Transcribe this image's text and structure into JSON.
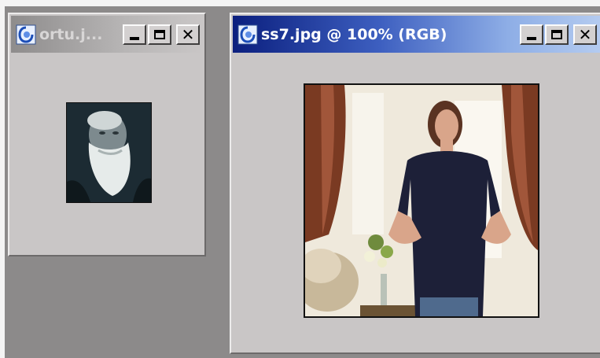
{
  "windows": [
    {
      "id": "inactive",
      "title": "ortu.j...",
      "state": "inactive",
      "image": "portrait of bearded elderly man (grayscale)"
    },
    {
      "id": "active",
      "title": "ss7.jpg @ 100% (RGB)",
      "state": "active",
      "image": "woman in navy t-shirt standing in living room"
    }
  ],
  "controls": {
    "minimize_icon": "minimize-icon",
    "maximize_icon": "maximize-icon",
    "close_glyph": "✕",
    "close_icon": "close-icon"
  },
  "colors": {
    "active_title_start": "#0b1f7e",
    "active_title_end": "#b4cbf0",
    "inactive_title": "#8e8c8c",
    "window_bg": "#c9c6c6",
    "desktop_bg": "#8c8a8a"
  }
}
